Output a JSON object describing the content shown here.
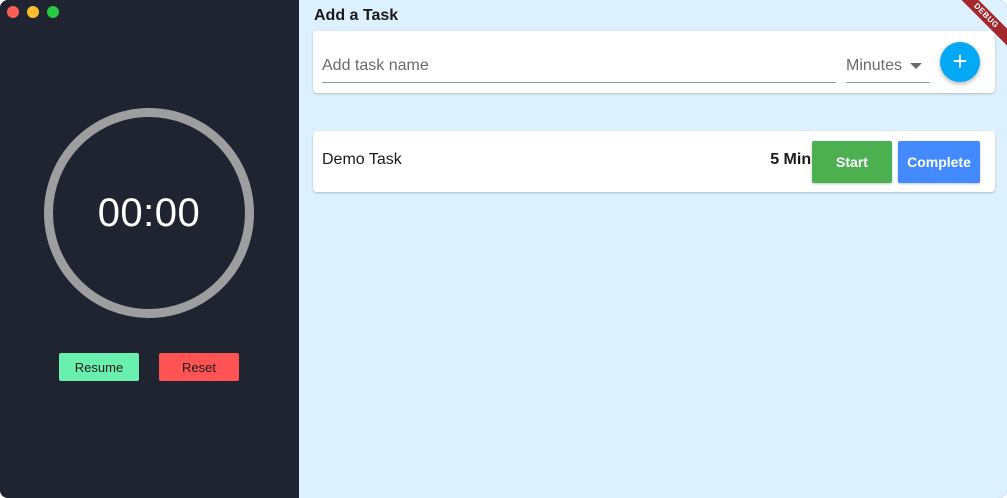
{
  "timer": {
    "display": "00:00",
    "resume_label": "Resume",
    "reset_label": "Reset"
  },
  "add_task": {
    "title": "Add a Task",
    "name_placeholder": "Add task name",
    "unit_selected": "Minutes",
    "add_icon": "plus-icon",
    "add_symbol": "+"
  },
  "tasks": [
    {
      "name": "Demo Task",
      "duration": "5 Mins",
      "start_label": "Start",
      "complete_label": "Complete"
    }
  ],
  "banner": {
    "label": "DEBUG"
  },
  "colors": {
    "sidebar_bg": "#1f2430",
    "content_bg": "#ddf0fd",
    "resume": "#69f0ae",
    "reset": "#ff5252",
    "add_button": "#03a9f4",
    "start": "#4caf50",
    "complete": "#448aff"
  }
}
